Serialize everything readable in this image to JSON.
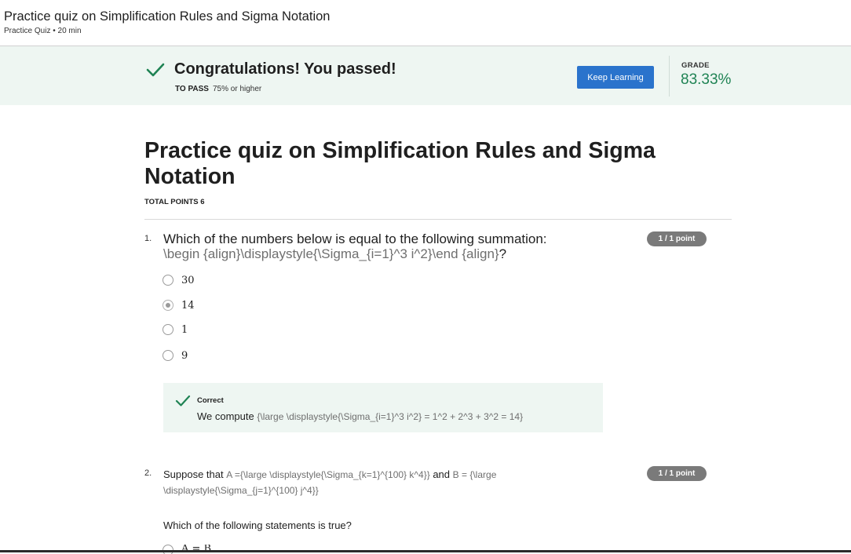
{
  "header": {
    "title": "Practice quiz on Simplification Rules and Sigma Notation",
    "subtitle": "Practice Quiz • 20 min"
  },
  "banner": {
    "message": "Congratulations! You passed!",
    "to_pass_label": "TO PASS",
    "to_pass_value": "75% or higher",
    "keep_learning_label": "Keep Learning",
    "grade_label": "GRADE",
    "grade_value": "83.33%",
    "colors": {
      "background": "#eef6f2",
      "check": "#1f8354",
      "button": "#2a73cc",
      "grade": "#1f8354"
    }
  },
  "quiz": {
    "title": "Practice quiz on Simplification Rules and Sigma Notation",
    "total_points": "TOTAL POINTS 6"
  },
  "questions": [
    {
      "number": "1.",
      "score": "1 / 1 point",
      "text": "Which of the numbers below is equal to the following summation:",
      "latex": "\\begin {align}\\displaystyle{\\Sigma_{i=1}^3 i^2}\\end {align}",
      "text_after": "?",
      "options": [
        {
          "label": "30",
          "selected": false
        },
        {
          "label": "14",
          "selected": true
        },
        {
          "label": "1",
          "selected": false
        },
        {
          "label": "9",
          "selected": false
        }
      ],
      "feedback": {
        "title": "Correct",
        "text": "We compute",
        "latex": "{\\large \\displaystyle{\\Sigma_{i=1}^3 i^2} = 1^2 + 2^3 + 3^2 = 14}"
      }
    },
    {
      "number": "2.",
      "score": "1 / 1 point",
      "text_part1": "Suppose that",
      "latex_a": "A ={\\large \\displaystyle{\\Sigma_{k=1}^{100} k^4}}",
      "text_part2": "and",
      "latex_b": "B = {\\large \\displaystyle{\\Sigma_{j=1}^{100} j^4}}",
      "prompt": "Which of the following statements is true?",
      "first_option_partial": "A = B"
    }
  ],
  "icons": {
    "banner_check": "checkmark-icon",
    "feedback_check": "checkmark-icon",
    "radio": "radio-button"
  }
}
